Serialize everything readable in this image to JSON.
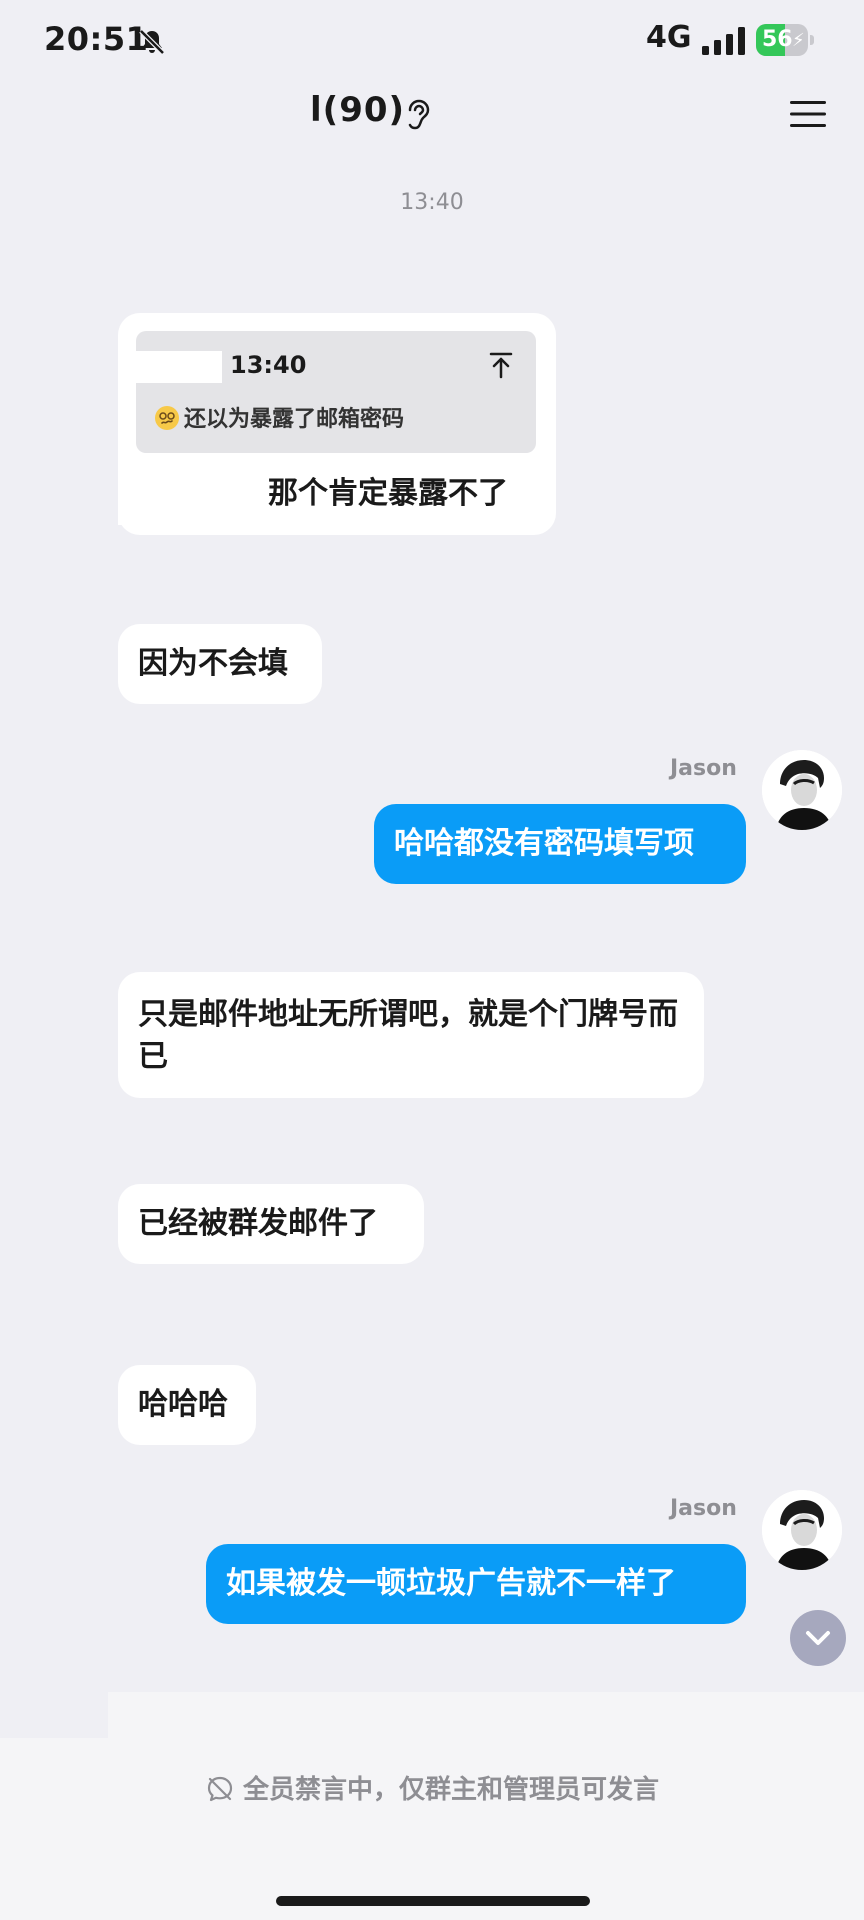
{
  "status_bar": {
    "time": "20:51",
    "network": "4G",
    "battery": "56",
    "battery_level": 0.56
  },
  "header": {
    "title": "l(90)",
    "ear_icon": "ear-icon",
    "menu_icon": "menu-icon"
  },
  "chat": {
    "timestamp": "13:40",
    "quote": {
      "time": "13:40",
      "text": "还以为暴露了邮箱密码",
      "reply": "那个肯定暴露不了"
    },
    "messages": [
      {
        "sender": "",
        "text": "因为不会填"
      },
      {
        "sender": "Jason",
        "text": "哈哈都没有密码填写项"
      },
      {
        "sender": "",
        "text": "只是邮件地址无所谓吧，就是个门牌号而已"
      },
      {
        "sender": "",
        "text": "已经被群发邮件了"
      },
      {
        "sender": "",
        "text": "哈哈哈"
      },
      {
        "sender": "Jason",
        "text": "如果被发一顿垃圾广告就不一样了"
      }
    ]
  },
  "footer": {
    "mute_notice": "全员禁言中，仅群主和管理员可发言"
  },
  "colors": {
    "outgoing_bubble": "#0a9cf7",
    "incoming_bubble": "#ffffff",
    "background": "#efeff4",
    "battery_green": "#34c759"
  }
}
